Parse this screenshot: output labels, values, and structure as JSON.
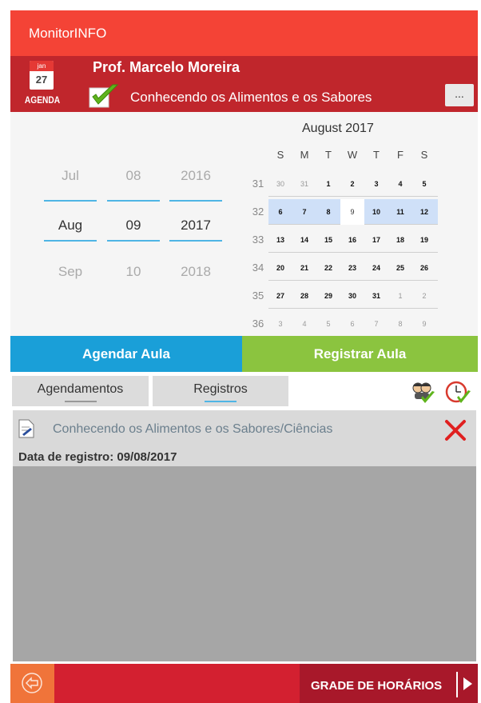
{
  "app": {
    "title": "MonitorINFO"
  },
  "header": {
    "agenda_icon": {
      "month": "jan",
      "day": "27",
      "label": "AGENDA"
    },
    "teacher_name": "Prof. Marcelo Moreira",
    "class_name": "Conhecendo os Alimentos e os Sabores",
    "more_label": "...",
    "check_icon": "checkmark-icon"
  },
  "picker": {
    "month": {
      "prev": "Jul",
      "current": "Aug",
      "next": "Sep"
    },
    "day": {
      "prev": "08",
      "current": "09",
      "next": "10"
    },
    "year": {
      "prev": "2016",
      "current": "2017",
      "next": "2018"
    }
  },
  "calendar": {
    "title": "August 2017",
    "weekdays": [
      "S",
      "M",
      "T",
      "W",
      "T",
      "F",
      "S"
    ],
    "weeks": [
      {
        "num": "31",
        "days": [
          "30",
          "31",
          "1",
          "2",
          "3",
          "4",
          "5"
        ],
        "dim": [
          true,
          true,
          false,
          false,
          false,
          false,
          false
        ],
        "selected": false
      },
      {
        "num": "32",
        "days": [
          "6",
          "7",
          "8",
          "9",
          "10",
          "11",
          "12"
        ],
        "dim": [
          false,
          false,
          false,
          false,
          false,
          false,
          false
        ],
        "selected": true,
        "today_index": 3
      },
      {
        "num": "33",
        "days": [
          "13",
          "14",
          "15",
          "16",
          "17",
          "18",
          "19"
        ],
        "dim": [
          false,
          false,
          false,
          false,
          false,
          false,
          false
        ],
        "selected": false
      },
      {
        "num": "34",
        "days": [
          "20",
          "21",
          "22",
          "23",
          "24",
          "25",
          "26"
        ],
        "dim": [
          false,
          false,
          false,
          false,
          false,
          false,
          false
        ],
        "selected": false
      },
      {
        "num": "35",
        "days": [
          "27",
          "28",
          "29",
          "30",
          "31",
          "1",
          "2"
        ],
        "dim": [
          false,
          false,
          false,
          false,
          false,
          true,
          true
        ],
        "selected": false
      },
      {
        "num": "36",
        "days": [
          "3",
          "4",
          "5",
          "6",
          "7",
          "8",
          "9"
        ],
        "dim": [
          true,
          true,
          true,
          true,
          true,
          true,
          true
        ],
        "selected": false
      }
    ]
  },
  "actions": {
    "agendar": "Agendar Aula",
    "registrar": "Registrar Aula"
  },
  "tabs": {
    "agendamentos": "Agendamentos",
    "registros": "Registros",
    "active": "registros"
  },
  "list": {
    "items": [
      {
        "title": "Conhecendo os Alimentos e os Sabores/Ciências",
        "date_label": "Data de registro: 09/08/2017",
        "icon": "document-edit-icon",
        "delete_icon": "delete-x-icon"
      }
    ]
  },
  "bottom": {
    "back_icon": "back-arrow-icon",
    "grade_label": "GRADE DE HORÁRIOS"
  },
  "colors": {
    "appbar": "#f44336",
    "header": "#c0262c",
    "agendar": "#1a9fd8",
    "registrar": "#8bc43f",
    "bottom_bar": "#d32030",
    "accent_line": "#4fb5e5"
  }
}
